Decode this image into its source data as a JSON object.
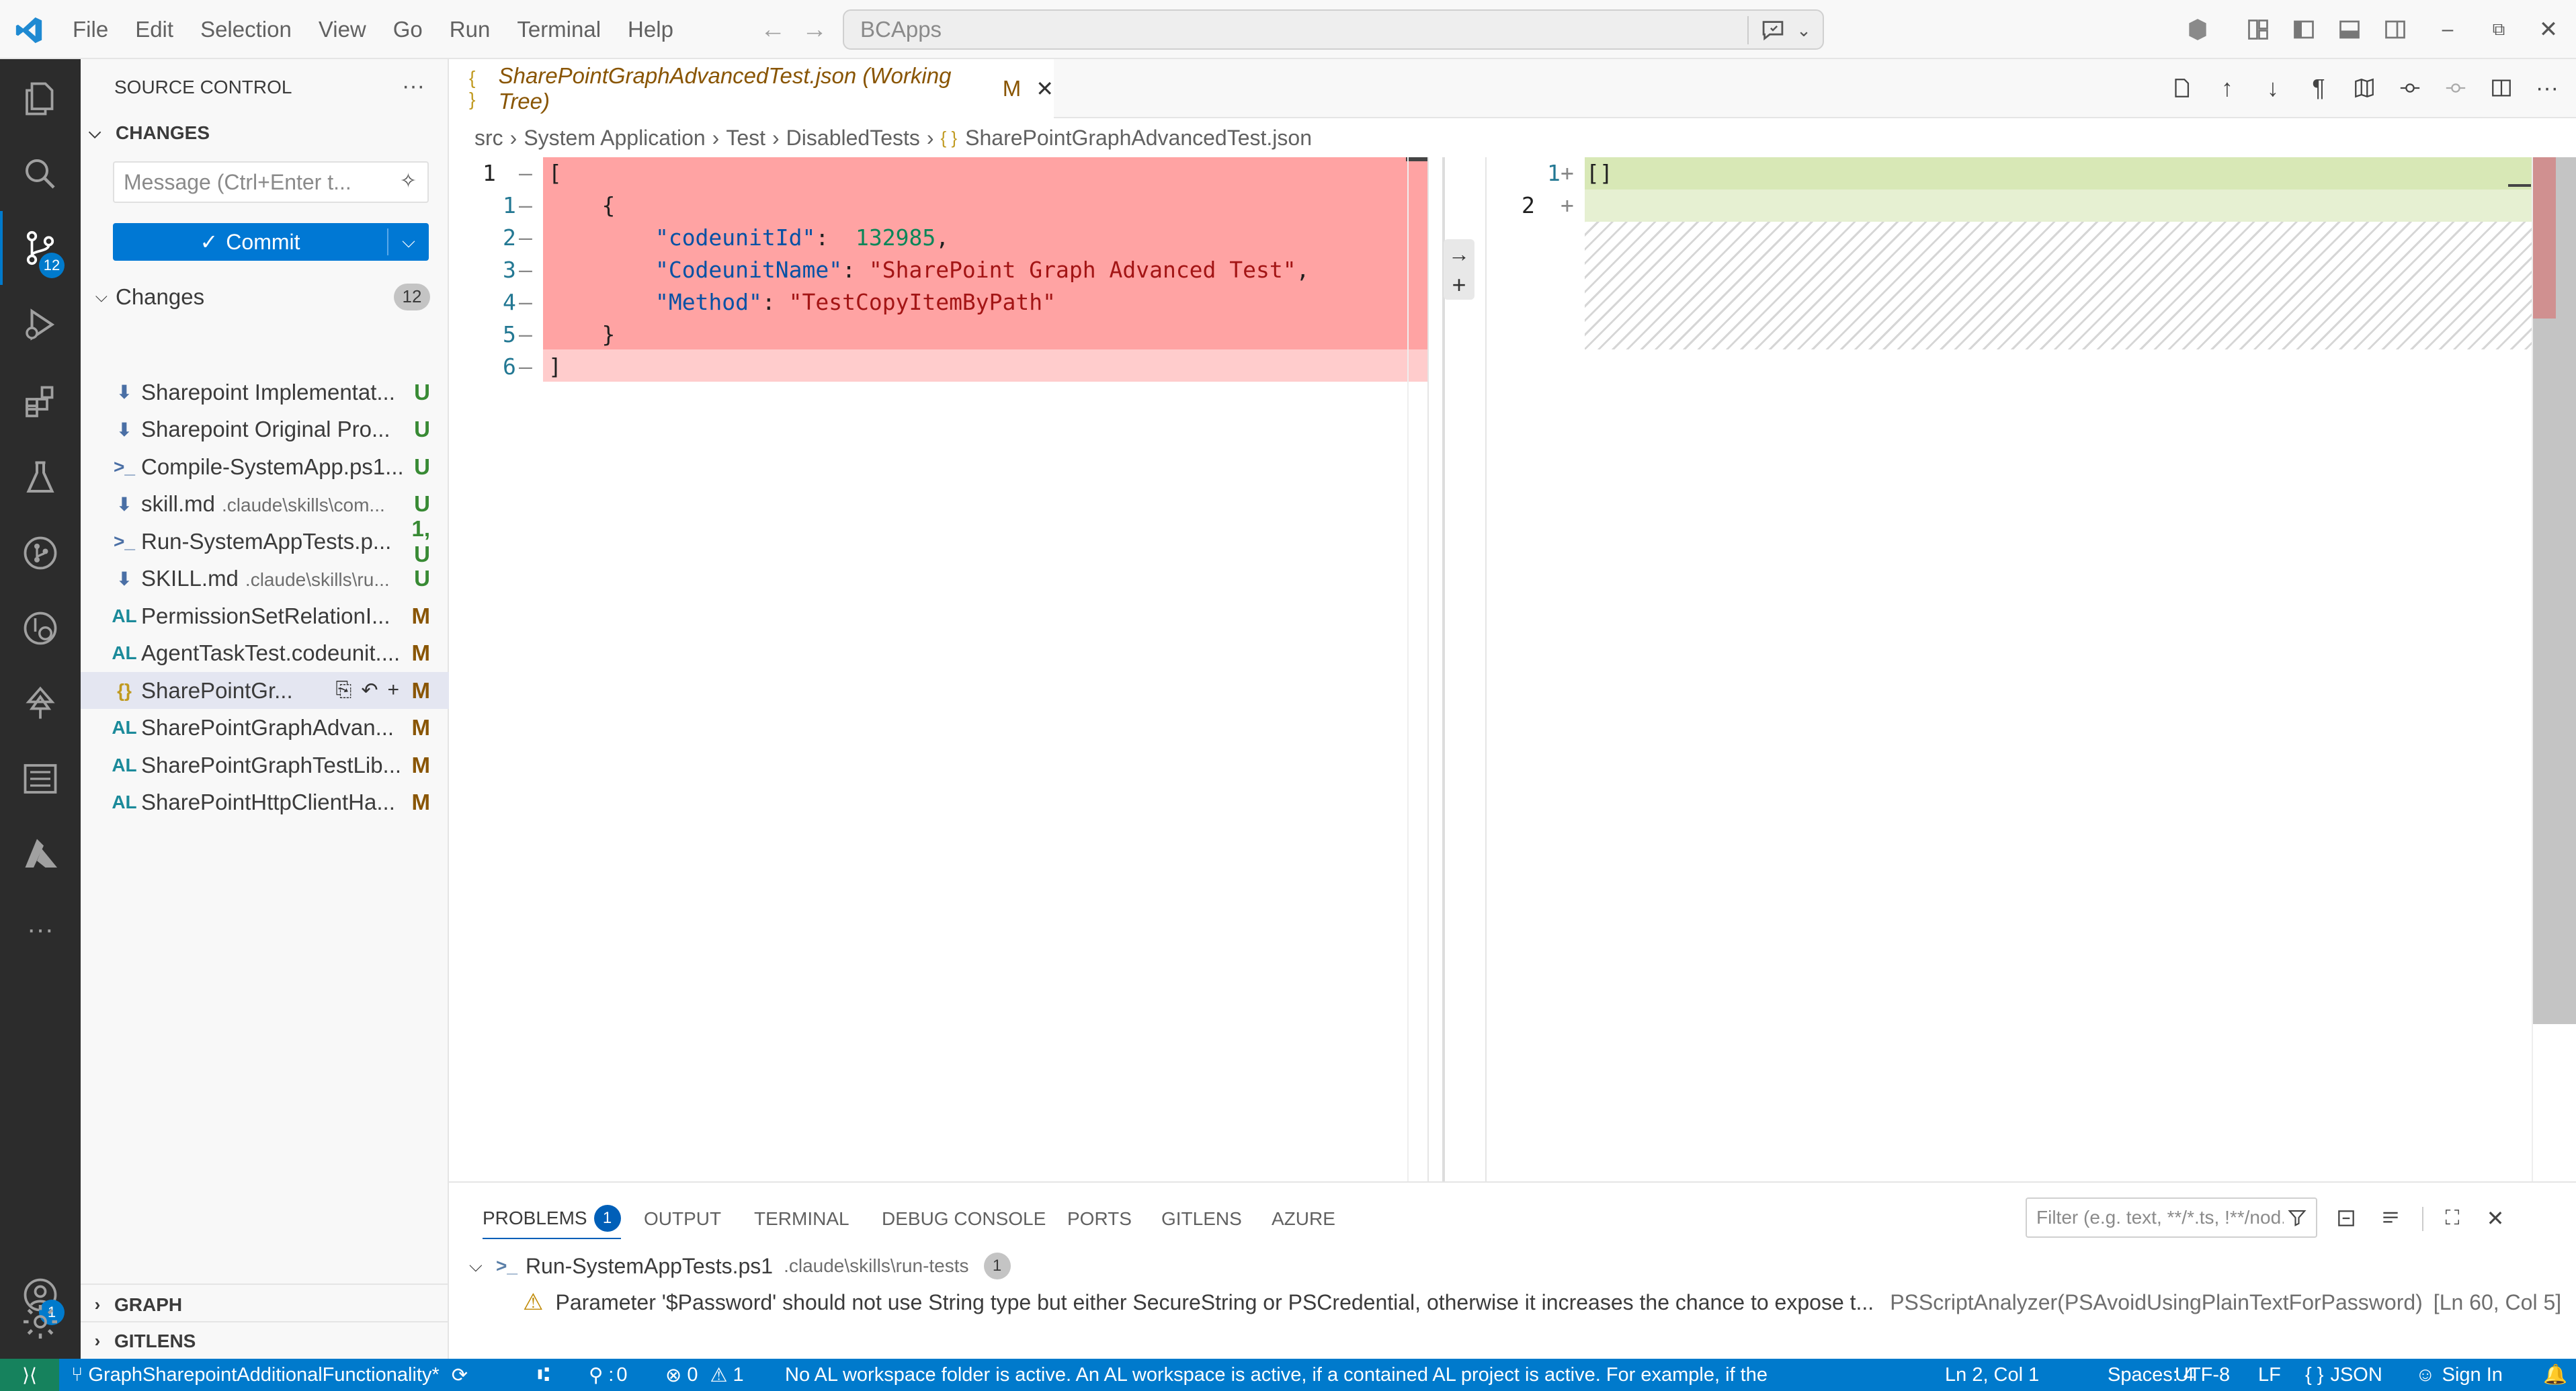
{
  "titlebar": {
    "menu": [
      "File",
      "Edit",
      "Selection",
      "View",
      "Go",
      "Run",
      "Terminal",
      "Help"
    ],
    "search_text": "BCApps"
  },
  "activity": {
    "source_control_badge": "12",
    "accounts_badge": "1"
  },
  "sidebar": {
    "title": "SOURCE CONTROL",
    "changes_header": "CHANGES",
    "message_placeholder": "Message (Ctrl+Enter t...",
    "commit_label": "Commit",
    "changes_group": "Changes",
    "changes_count": "12",
    "files": [
      {
        "icon": "⬇",
        "name": "Sharepoint Implementat...",
        "path": "",
        "status": "U"
      },
      {
        "icon": "⬇",
        "name": "Sharepoint Original Pro...",
        "path": "",
        "status": "U"
      },
      {
        "icon": ">_",
        "name": "Compile-SystemApp.ps1...",
        "path": "",
        "status": "U"
      },
      {
        "icon": "⬇",
        "name": "skill.md",
        "path": ".claude\\skills\\com...",
        "status": "U"
      },
      {
        "icon": ">_",
        "name": "Run-SystemAppTests.p...",
        "path": "",
        "status": "1, U"
      },
      {
        "icon": "⬇",
        "name": "SKILL.md",
        "path": ".claude\\skills\\ru...",
        "status": "U"
      },
      {
        "icon": "AL",
        "name": "PermissionSetRelationI...",
        "path": "",
        "status": "M"
      },
      {
        "icon": "AL",
        "name": "AgentTaskTest.codeunit....",
        "path": "",
        "status": "M"
      },
      {
        "icon": "{}",
        "name": "SharePointGr...",
        "path": "",
        "status": "M"
      },
      {
        "icon": "AL",
        "name": "SharePointGraphAdvan...",
        "path": "",
        "status": "M"
      },
      {
        "icon": "AL",
        "name": "SharePointGraphTestLib...",
        "path": "",
        "status": "M"
      },
      {
        "icon": "AL",
        "name": "SharePointHttpClientHa...",
        "path": "",
        "status": "M"
      }
    ],
    "graph_label": "GRAPH",
    "gitlens_label": "GITLENS"
  },
  "editor": {
    "tab_title": "SharePointGraphAdvancedTest.json (Working Tree)",
    "tab_status": "M",
    "breadcrumbs": [
      "src",
      "System Application",
      "Test",
      "DisabledTests",
      "SharePointGraphAdvancedTest.json"
    ],
    "left_lines": [
      {
        "num": "1",
        "mark": "—",
        "text": "["
      },
      {
        "num": "1",
        "mark": "—",
        "text": "    {"
      },
      {
        "num": "2",
        "mark": "—",
        "key": "\"codeunitId\"",
        "sep": ":  ",
        "val": "132985",
        "valtype": "num",
        "tail": ","
      },
      {
        "num": "3",
        "mark": "—",
        "key": "\"CodeunitName\"",
        "sep": ": ",
        "val": "\"SharePoint Graph Advanced Test\"",
        "valtype": "str",
        "tail": ","
      },
      {
        "num": "4",
        "mark": "—",
        "key": "\"Method\"",
        "sep": ": ",
        "val": "\"TestCopyItemByPath\"",
        "valtype": "str",
        "tail": ""
      },
      {
        "num": "5",
        "mark": "—",
        "text": "    }"
      },
      {
        "num": "6",
        "mark": "—",
        "text": "]"
      }
    ],
    "right_lines": [
      {
        "num": "1",
        "mark": "+",
        "text": "[]"
      },
      {
        "num": "2",
        "mark": "+",
        "text": ""
      }
    ]
  },
  "panel": {
    "tabs": [
      "PROBLEMS",
      "OUTPUT",
      "TERMINAL",
      "DEBUG CONSOLE",
      "PORTS",
      "GITLENS",
      "AZURE"
    ],
    "problems_badge": "1",
    "filter_placeholder": "Filter (e.g. text, **/*.ts, !**/nod...",
    "file_name": "Run-SystemAppTests.ps1",
    "file_path": ".claude\\skills\\run-tests",
    "file_count": "1",
    "message": "Parameter '$Password' should not use String type but either SecureString or PSCredential, otherwise it increases the chance to expose t...",
    "source": "PSScriptAnalyzer(PSAvoidUsingPlainTextForPassword)",
    "location": "[Ln 60, Col 5]"
  },
  "status": {
    "branch": "GraphSharepointAdditionalFunctionality*",
    "ports": "0",
    "errors": "0",
    "warnings": "1",
    "message": "No AL workspace folder is active. An AL workspace is active, if a contained AL project is active. For example, if the",
    "position": "Ln 2, Col 1",
    "spaces": "Spaces: 4",
    "encoding": "UTF-8",
    "eol": "LF",
    "language": "JSON",
    "signin": "Sign In"
  },
  "colors": {
    "accent": "#007acc",
    "deleted": "#ffa3a3",
    "deleted_light": "#ffcccc",
    "inserted": "#d8e8b6",
    "activity_bg": "#2c2c2c"
  }
}
